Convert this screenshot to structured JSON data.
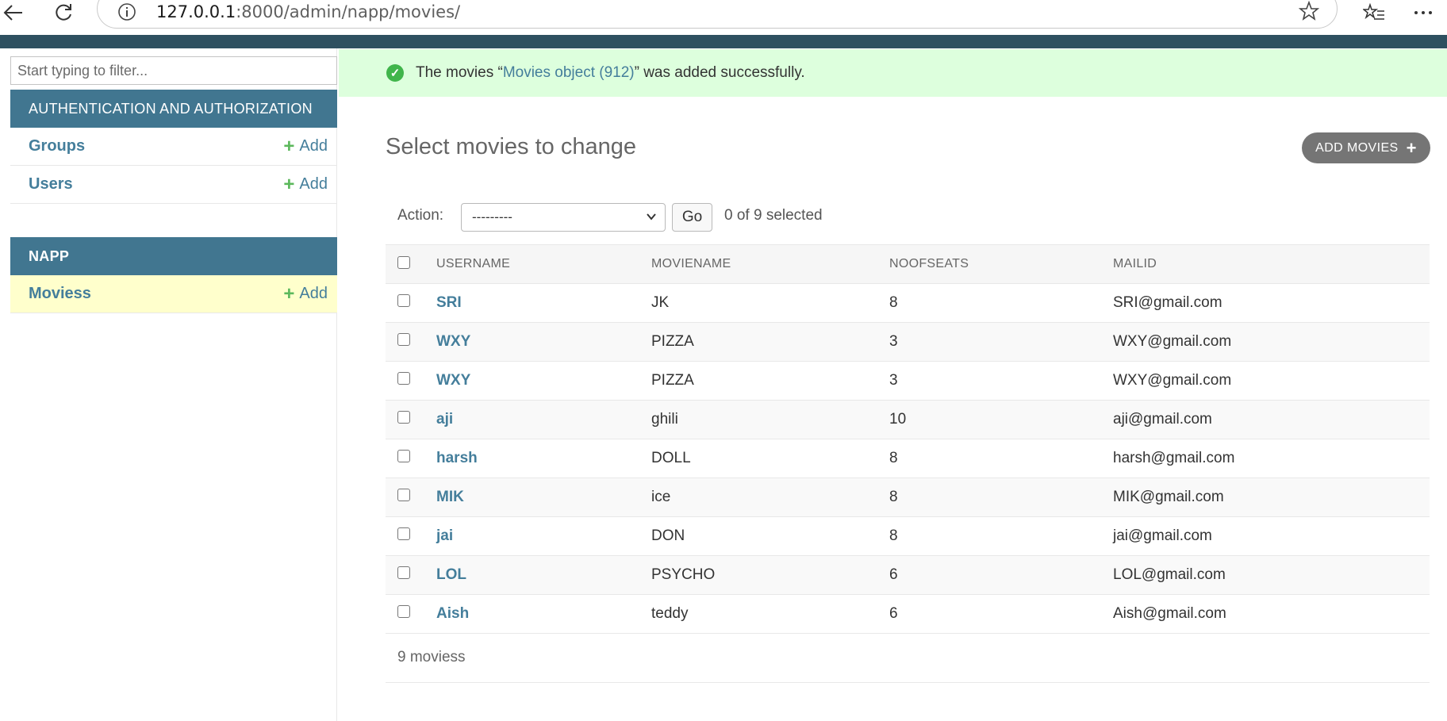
{
  "browser": {
    "url_host": "127.0.0.1",
    "url_rest": ":8000/admin/napp/movies/"
  },
  "sidebar": {
    "filter_placeholder": "Start typing to filter...",
    "modules": [
      {
        "caption": "AUTHENTICATION AND AUTHORIZATION",
        "models": [
          {
            "name": "Groups",
            "add_label": "Add"
          },
          {
            "name": "Users",
            "add_label": "Add"
          }
        ]
      },
      {
        "caption": "NAPP",
        "models": [
          {
            "name": "Moviess",
            "add_label": "Add",
            "current": true
          }
        ]
      }
    ]
  },
  "message": {
    "prefix": "The movies “",
    "link": "Movies object (912)",
    "suffix": "” was added successfully."
  },
  "content": {
    "title": "Select movies to change",
    "add_button": "ADD MOVIES",
    "action_label": "Action:",
    "action_selected": "---------",
    "go_label": "Go",
    "selection_count": "0 of 9 selected",
    "columns": [
      "USERNAME",
      "MOVIENAME",
      "NOOFSEATS",
      "MAILID"
    ],
    "rows": [
      {
        "username": "SRI",
        "moviename": "JK",
        "seats": "8",
        "mail": "SRI@gmail.com"
      },
      {
        "username": "WXY",
        "moviename": "PIZZA",
        "seats": "3",
        "mail": "WXY@gmail.com"
      },
      {
        "username": "WXY",
        "moviename": "PIZZA",
        "seats": "3",
        "mail": "WXY@gmail.com"
      },
      {
        "username": "aji",
        "moviename": "ghili",
        "seats": "10",
        "mail": "aji@gmail.com"
      },
      {
        "username": "harsh",
        "moviename": "DOLL",
        "seats": "8",
        "mail": "harsh@gmail.com"
      },
      {
        "username": "MIK",
        "moviename": "ice",
        "seats": "8",
        "mail": "MIK@gmail.com"
      },
      {
        "username": "jai",
        "moviename": "DON",
        "seats": "8",
        "mail": "jai@gmail.com"
      },
      {
        "username": "LOL",
        "moviename": "PSYCHO",
        "seats": "6",
        "mail": "LOL@gmail.com"
      },
      {
        "username": "Aish",
        "moviename": "teddy",
        "seats": "6",
        "mail": "Aish@gmail.com"
      }
    ],
    "paginator": "9 moviess"
  },
  "colors": {
    "header": "#2e5060",
    "module_caption": "#417690",
    "link": "#447e9b",
    "success_bg": "#ddffdd",
    "add_plus": "#5cb85c"
  }
}
